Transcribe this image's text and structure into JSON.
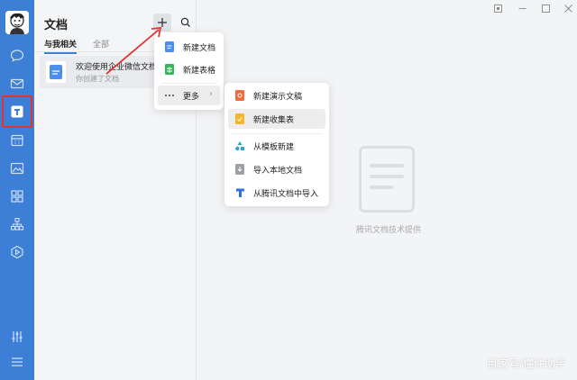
{
  "panel": {
    "title": "文档",
    "tabs": [
      {
        "label": "与我相关",
        "active": true
      },
      {
        "label": "全部",
        "active": false
      }
    ],
    "doc_item": {
      "name": "欢迎使用企业微信文档",
      "sub": "你创建了文档"
    }
  },
  "menu_primary": {
    "items": [
      {
        "label": "新建文档",
        "icon": "doc-icon"
      },
      {
        "label": "新建表格",
        "icon": "sheet-icon"
      },
      {
        "label": "更多",
        "icon": "more-icon"
      }
    ]
  },
  "menu_more": {
    "items": [
      {
        "label": "新建演示文稿",
        "icon": "slides-icon"
      },
      {
        "label": "新建收集表",
        "icon": "form-icon"
      },
      {
        "label": "从模板新建",
        "icon": "template-icon"
      },
      {
        "label": "导入本地文档",
        "icon": "import-icon"
      },
      {
        "label": "从腾讯文档中导入",
        "icon": "tencent-docs-icon"
      }
    ]
  },
  "main": {
    "empty_text": "腾讯文档技术提供",
    "watermark": "百家号/懂件助手"
  },
  "colors": {
    "rail": "#3d7fd6",
    "highlight_box": "#e03434",
    "doc_blue": "#4a8ef0",
    "sheet_green": "#37b45c",
    "slides_orange": "#f0693a",
    "form_yellow": "#f5b52a"
  }
}
